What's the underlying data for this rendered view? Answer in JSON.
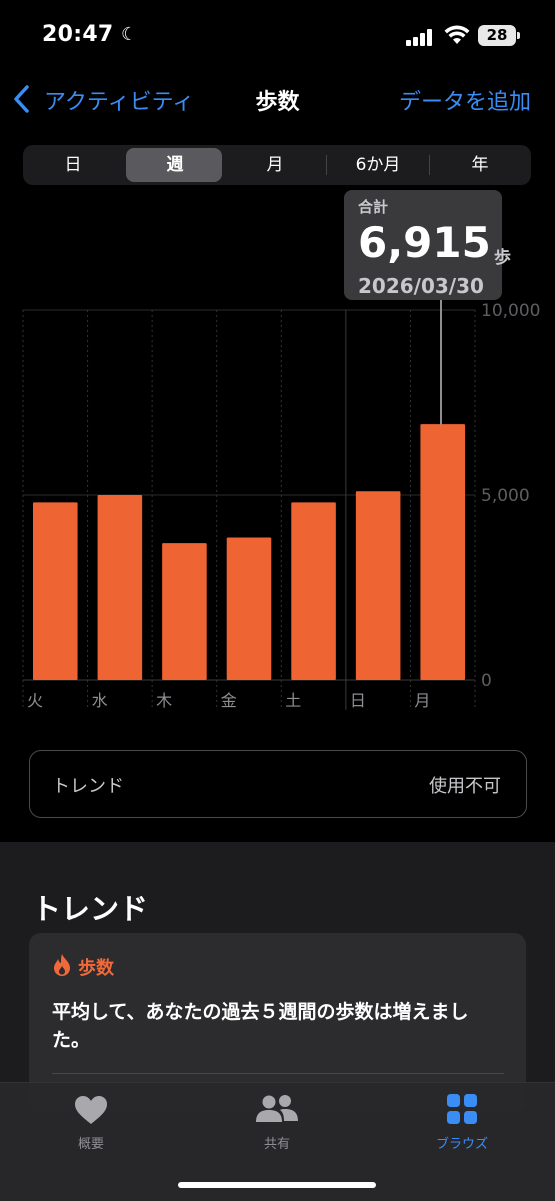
{
  "status": {
    "time": "20:47",
    "battery": "28"
  },
  "nav": {
    "back_label": "アクティビティ",
    "title": "歩数",
    "add_label": "データを追加"
  },
  "segments": [
    "日",
    "週",
    "月",
    "6か月",
    "年"
  ],
  "tooltip": {
    "label": "合計",
    "value": "6,915",
    "unit": "歩",
    "date": "2026/03/30"
  },
  "chart_data": {
    "type": "bar",
    "categories": [
      "火",
      "水",
      "木",
      "金",
      "土",
      "日",
      "月"
    ],
    "values": [
      4800,
      5000,
      3700,
      3850,
      4800,
      5100,
      6915
    ],
    "ylim": [
      0,
      10000
    ],
    "yticks": [
      "10,000",
      "5,000",
      "0"
    ],
    "selected_index": 6,
    "bar_color": "#ee6432"
  },
  "trend_pill": {
    "label": "トレンド",
    "value": "使用不可"
  },
  "trends": {
    "header": "トレンド",
    "card": {
      "category": "歩数",
      "text": "平均して、あなたの過去５週間の歩数は増えました。"
    }
  },
  "tabs": [
    {
      "label": "概要",
      "icon": "heart-icon",
      "active": false
    },
    {
      "label": "共有",
      "icon": "people-icon",
      "active": false
    },
    {
      "label": "ブラウズ",
      "icon": "grid-icon",
      "active": true
    }
  ],
  "colors": {
    "accent": "#3a8df5",
    "orange": "#ee6432"
  }
}
